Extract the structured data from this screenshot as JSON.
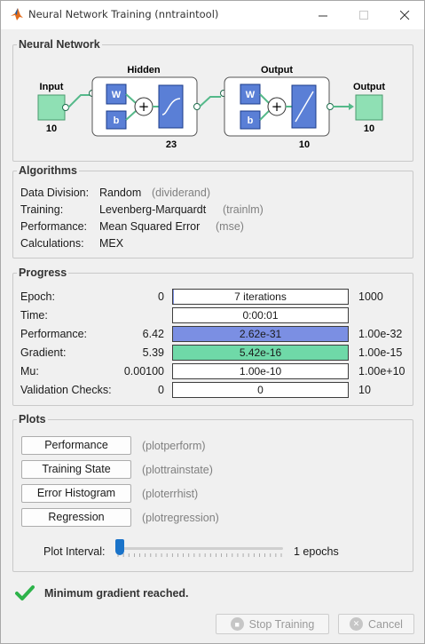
{
  "window": {
    "title": "Neural Network Training (nntraintool)"
  },
  "network": {
    "panel_title": "Neural Network",
    "input_label": "Input",
    "input_size": "10",
    "hidden_label": "Hidden",
    "hidden_size": "23",
    "output_layer_label": "Output",
    "output_layer_size": "10",
    "output_label": "Output",
    "output_size": "10",
    "weight_label": "W",
    "bias_label": "b"
  },
  "algorithms": {
    "panel_title": "Algorithms",
    "rows": [
      {
        "key": "Data Division:",
        "value": "Random",
        "func": "(dividerand)"
      },
      {
        "key": "Training:",
        "value": "Levenberg-Marquardt",
        "func": "(trainlm)"
      },
      {
        "key": "Performance:",
        "value": "Mean Squared Error",
        "func": "(mse)"
      },
      {
        "key": "Calculations:",
        "value": "MEX",
        "func": ""
      }
    ]
  },
  "progress": {
    "panel_title": "Progress",
    "rows": [
      {
        "label": "Epoch:",
        "start": "0",
        "current": "7 iterations",
        "end": "1000",
        "fill_fraction": 0.007,
        "fill_color": "#ffffff"
      },
      {
        "label": "Time:",
        "start": "",
        "current": "0:00:01",
        "end": "",
        "fill_fraction": 0,
        "fill_color": "#ffffff"
      },
      {
        "label": "Performance:",
        "start": "6.42",
        "current": "2.62e-31",
        "end": "1.00e-32",
        "fill_fraction": 1.0,
        "fill_color": "#7b8fe3"
      },
      {
        "label": "Gradient:",
        "start": "5.39",
        "current": "5.42e-16",
        "end": "1.00e-15",
        "fill_fraction": 1.0,
        "fill_color": "#6fd9a8"
      },
      {
        "label": "Mu:",
        "start": "0.00100",
        "current": "1.00e-10",
        "end": "1.00e+10",
        "fill_fraction": 0,
        "fill_color": "#ffffff"
      },
      {
        "label": "Validation Checks:",
        "start": "0",
        "current": "0",
        "end": "10",
        "fill_fraction": 0,
        "fill_color": "#ffffff"
      }
    ]
  },
  "plots": {
    "panel_title": "Plots",
    "buttons": [
      {
        "label": "Performance",
        "func": "(plotperform)"
      },
      {
        "label": "Training State",
        "func": "(plottrainstate)"
      },
      {
        "label": "Error Histogram",
        "func": "(ploterrhist)"
      },
      {
        "label": "Regression",
        "func": "(plotregression)"
      }
    ],
    "interval_label": "Plot Interval:",
    "interval_value": "1 epochs",
    "interval_fraction": 0.0
  },
  "status": {
    "icon": "check-icon",
    "message": "Minimum gradient reached."
  },
  "footer": {
    "stop_label": "Stop Training",
    "cancel_label": "Cancel"
  },
  "colors": {
    "node_green": "#8fe0b4",
    "weight_blue": "#5a7fd6",
    "performance_fill": "#7b8fe3",
    "gradient_fill": "#6fd9a8",
    "check_green": "#2db34a"
  }
}
